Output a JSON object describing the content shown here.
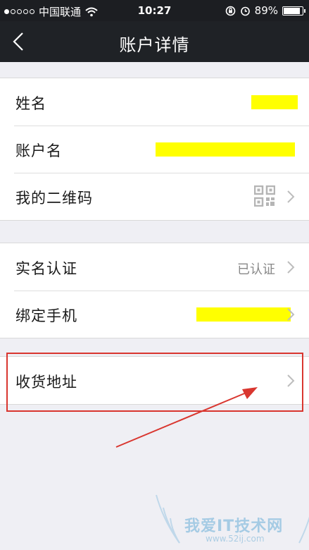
{
  "status_bar": {
    "carrier": "中国联通",
    "time": "10:27",
    "battery": "89%",
    "battery_level": 0.89,
    "icons": [
      "signal-dots",
      "wifi-icon",
      "rotation-lock-icon",
      "alarm-icon",
      "battery-icon"
    ]
  },
  "nav": {
    "title": "账户详情",
    "back_icon": "chevron-left-icon"
  },
  "groups": [
    {
      "rows": [
        {
          "label": "姓名",
          "value": "",
          "redacted": true
        },
        {
          "label": "账户名",
          "value": "",
          "redacted": true
        },
        {
          "label": "我的二维码",
          "icon": "qr-code-icon",
          "chevron": true
        }
      ]
    },
    {
      "rows": [
        {
          "label": "实名认证",
          "value": "已认证",
          "chevron": true
        },
        {
          "label": "绑定手机",
          "value": "",
          "redacted": true,
          "chevron": true
        }
      ]
    },
    {
      "rows": [
        {
          "label": "收货地址",
          "chevron": true
        }
      ]
    }
  ],
  "annotation": {
    "highlight_color": "#d9362f",
    "redaction_color": "#ffff00"
  },
  "watermark": {
    "text": "我爱IT技术网",
    "url": "www.52ij.com"
  }
}
